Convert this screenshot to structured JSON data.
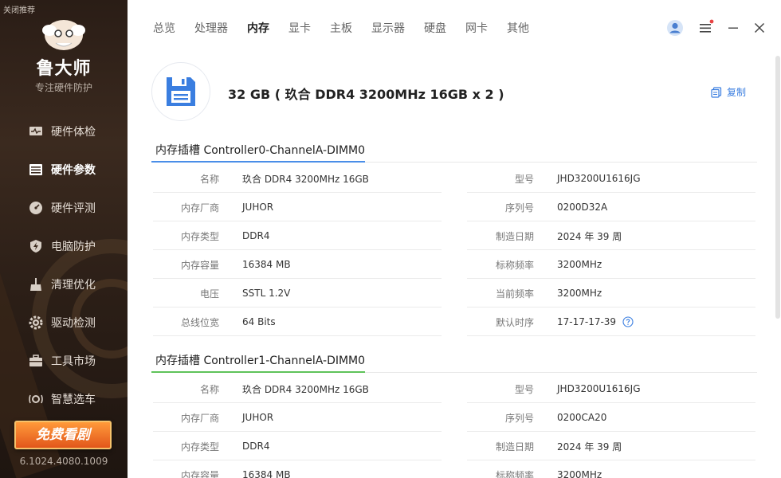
{
  "sidebar": {
    "recommend_toggle": "关闭推荐",
    "brand": "鲁大师",
    "slogan": "专注硬件防护",
    "items": [
      {
        "label": "硬件体检",
        "icon": "monitor-pulse-icon"
      },
      {
        "label": "硬件参数",
        "icon": "list-icon"
      },
      {
        "label": "硬件评测",
        "icon": "speedometer-icon"
      },
      {
        "label": "电脑防护",
        "icon": "shield-icon"
      },
      {
        "label": "清理优化",
        "icon": "broom-icon"
      },
      {
        "label": "驱动检测",
        "icon": "gear-icon"
      },
      {
        "label": "工具市场",
        "icon": "toolbox-icon"
      },
      {
        "label": "智慧选车",
        "icon": "car-icon"
      }
    ],
    "active_index": 1,
    "promo": "免费看剧",
    "version": "6.1024.4080.1009"
  },
  "top_tabs": [
    "总览",
    "处理器",
    "内存",
    "显卡",
    "主板",
    "显示器",
    "硬盘",
    "网卡",
    "其他"
  ],
  "active_tab": "内存",
  "colors": {
    "accent_blue": "#3a7ee0",
    "slot1_underline": "#4a8ee8",
    "slot2_underline": "#5fc35a",
    "notification_dot": "#e84343"
  },
  "summary": {
    "title": "32 GB ( 玖合 DDR4 3200MHz 16GB x 2 )",
    "copy": "复制"
  },
  "slots": [
    {
      "title": "内存插槽 Controller0-ChannelA-DIMM0",
      "left": [
        {
          "label": "名称",
          "value": "玖合 DDR4 3200MHz 16GB"
        },
        {
          "label": "内存厂商",
          "value": "JUHOR"
        },
        {
          "label": "内存类型",
          "value": "DDR4"
        },
        {
          "label": "内存容量",
          "value": "16384 MB"
        },
        {
          "label": "电压",
          "value": "SSTL 1.2V"
        },
        {
          "label": "总线位宽",
          "value": "64 Bits"
        }
      ],
      "right": [
        {
          "label": "型号",
          "value": "JHD3200U1616JG"
        },
        {
          "label": "序列号",
          "value": "0200D32A"
        },
        {
          "label": "制造日期",
          "value": "2024 年 39 周"
        },
        {
          "label": "标称频率",
          "value": "3200MHz"
        },
        {
          "label": "当前频率",
          "value": "3200MHz"
        },
        {
          "label": "默认时序",
          "value": "17-17-17-39"
        }
      ]
    },
    {
      "title": "内存插槽 Controller1-ChannelA-DIMM0",
      "left": [
        {
          "label": "名称",
          "value": "玖合 DDR4 3200MHz 16GB"
        },
        {
          "label": "内存厂商",
          "value": "JUHOR"
        },
        {
          "label": "内存类型",
          "value": "DDR4"
        },
        {
          "label": "内存容量",
          "value": "16384 MB"
        }
      ],
      "right": [
        {
          "label": "型号",
          "value": "JHD3200U1616JG"
        },
        {
          "label": "序列号",
          "value": "0200CA20"
        },
        {
          "label": "制造日期",
          "value": "2024 年 39 周"
        },
        {
          "label": "标称频率",
          "value": "3200MHz"
        }
      ]
    }
  ]
}
